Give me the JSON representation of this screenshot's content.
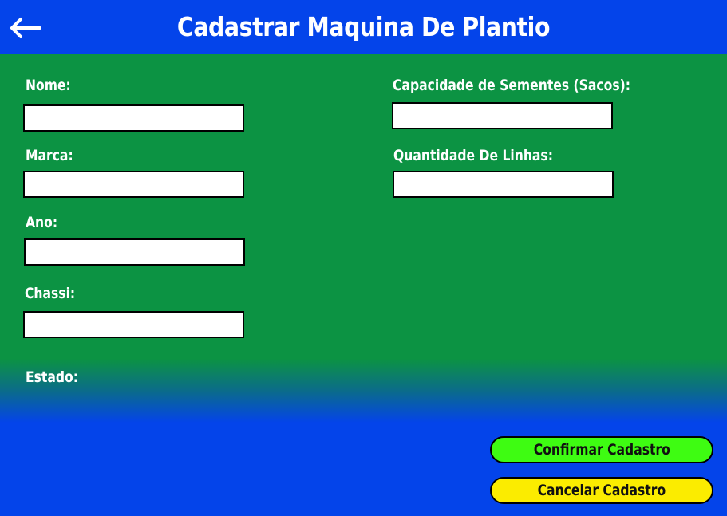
{
  "header": {
    "title": "Cadastrar Maquina De Plantio",
    "back_icon": "arrow-left-icon"
  },
  "form": {
    "nome": {
      "label": "Nome:",
      "value": ""
    },
    "marca": {
      "label": "Marca:",
      "value": ""
    },
    "ano": {
      "label": "Ano:",
      "value": ""
    },
    "chassi": {
      "label": "Chassi:",
      "value": ""
    },
    "estado": {
      "label": "Estado:"
    },
    "capacidade": {
      "label": "Capacidade de Sementes (Sacos):",
      "value": ""
    },
    "linhas": {
      "label": "Quantidade De Linhas:",
      "value": ""
    }
  },
  "actions": {
    "confirm_label": "Confirmar Cadastro",
    "cancel_label": "Cancelar Cadastro"
  },
  "colors": {
    "header_bg": "#0444ea",
    "form_bg": "#0c9343",
    "confirm_bg": "#3efc12",
    "cancel_bg": "#fbec00"
  }
}
